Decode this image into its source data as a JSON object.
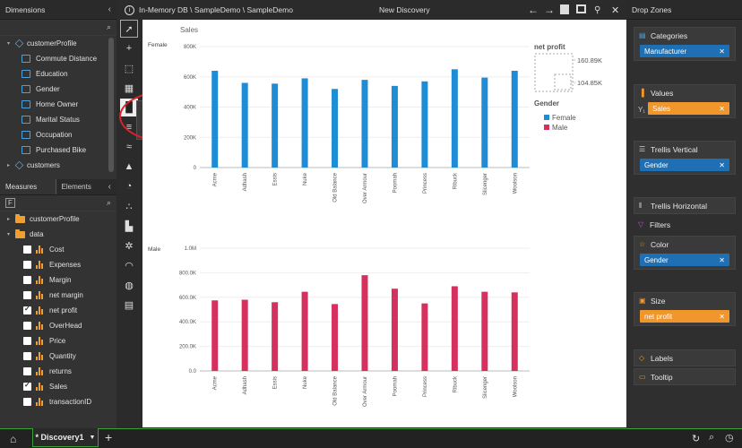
{
  "dimensions": {
    "title": "Dimensions",
    "root": "customerProfile",
    "items": [
      "Commute Distance",
      "Education",
      "Gender",
      "Home Owner",
      "Marital Status",
      "Occupation",
      "Purchased Bike"
    ],
    "next_root": "customers"
  },
  "measures_panel": {
    "tab_measures": "Measures",
    "tab_elements": "Elements",
    "group1": "customerProfile",
    "group2": "data",
    "items": [
      {
        "label": "Cost",
        "checked": false
      },
      {
        "label": "Expenses",
        "checked": false
      },
      {
        "label": "Margin",
        "checked": false
      },
      {
        "label": "net margin",
        "checked": false
      },
      {
        "label": "net profit",
        "checked": true
      },
      {
        "label": "OverHead",
        "checked": false
      },
      {
        "label": "Price",
        "checked": false
      },
      {
        "label": "Quantity",
        "checked": false
      },
      {
        "label": "returns",
        "checked": false
      },
      {
        "label": "Sales",
        "checked": true
      },
      {
        "label": "transactionID",
        "checked": false
      }
    ]
  },
  "topbar": {
    "info_icon": "info-icon",
    "breadcrumb": "In-Memory DB \\ SampleDemo \\ SampleDemo",
    "title": "New Discovery"
  },
  "chart_data": {
    "type": "bar",
    "title": "Sales",
    "categories": [
      "Acme",
      "Adhash",
      "Essis",
      "Nuke",
      "Old Balance",
      "Over Armour",
      "Poomah",
      "Princess",
      "Ribuck",
      "Slicenger",
      "Woolson"
    ],
    "series": [
      {
        "name": "Female",
        "color": "#1f8dd6",
        "values": [
          640000,
          560000,
          555000,
          590000,
          520000,
          580000,
          540000,
          570000,
          650000,
          595000,
          640000
        ]
      },
      {
        "name": "Male",
        "color": "#d6305e",
        "values": [
          575000,
          580000,
          560000,
          645000,
          545000,
          780000,
          670000,
          550000,
          690000,
          645000,
          640000
        ]
      }
    ],
    "female_panel": {
      "label": "Female",
      "ylim": [
        0,
        800000
      ],
      "ticks": [
        "0",
        "200K",
        "400K",
        "600K",
        "800K"
      ]
    },
    "male_panel": {
      "label": "Male",
      "ylim": [
        0,
        1000000
      ],
      "ticks": [
        "0.0",
        "200.0K",
        "400.0K",
        "600.0K",
        "800.0K",
        "1.0M"
      ]
    },
    "size_legend": {
      "title": "net profit",
      "max": "160.89K",
      "min": "104.85K"
    },
    "color_legend": {
      "title": "Gender",
      "entries": [
        "Female",
        "Male"
      ]
    }
  },
  "drop_zones": {
    "title": "Drop Zones",
    "categories": {
      "label": "Categories",
      "pill": "Manufacturer"
    },
    "values": {
      "label": "Values",
      "axis": "Y₁",
      "pill": "Sales"
    },
    "trellis_vertical": {
      "label": "Trellis Vertical",
      "pill": "Gender"
    },
    "trellis_horizontal": {
      "label": "Trellis Horizontal"
    },
    "filters": {
      "label": "Filters"
    },
    "color": {
      "label": "Color",
      "pill": "Gender"
    },
    "size": {
      "label": "Size",
      "pill": "net profit"
    },
    "labels": {
      "label": "Labels"
    },
    "tooltip": {
      "label": "Tooltip"
    }
  },
  "bottom": {
    "doc_tab": "* Discovery1",
    "add": "+"
  }
}
